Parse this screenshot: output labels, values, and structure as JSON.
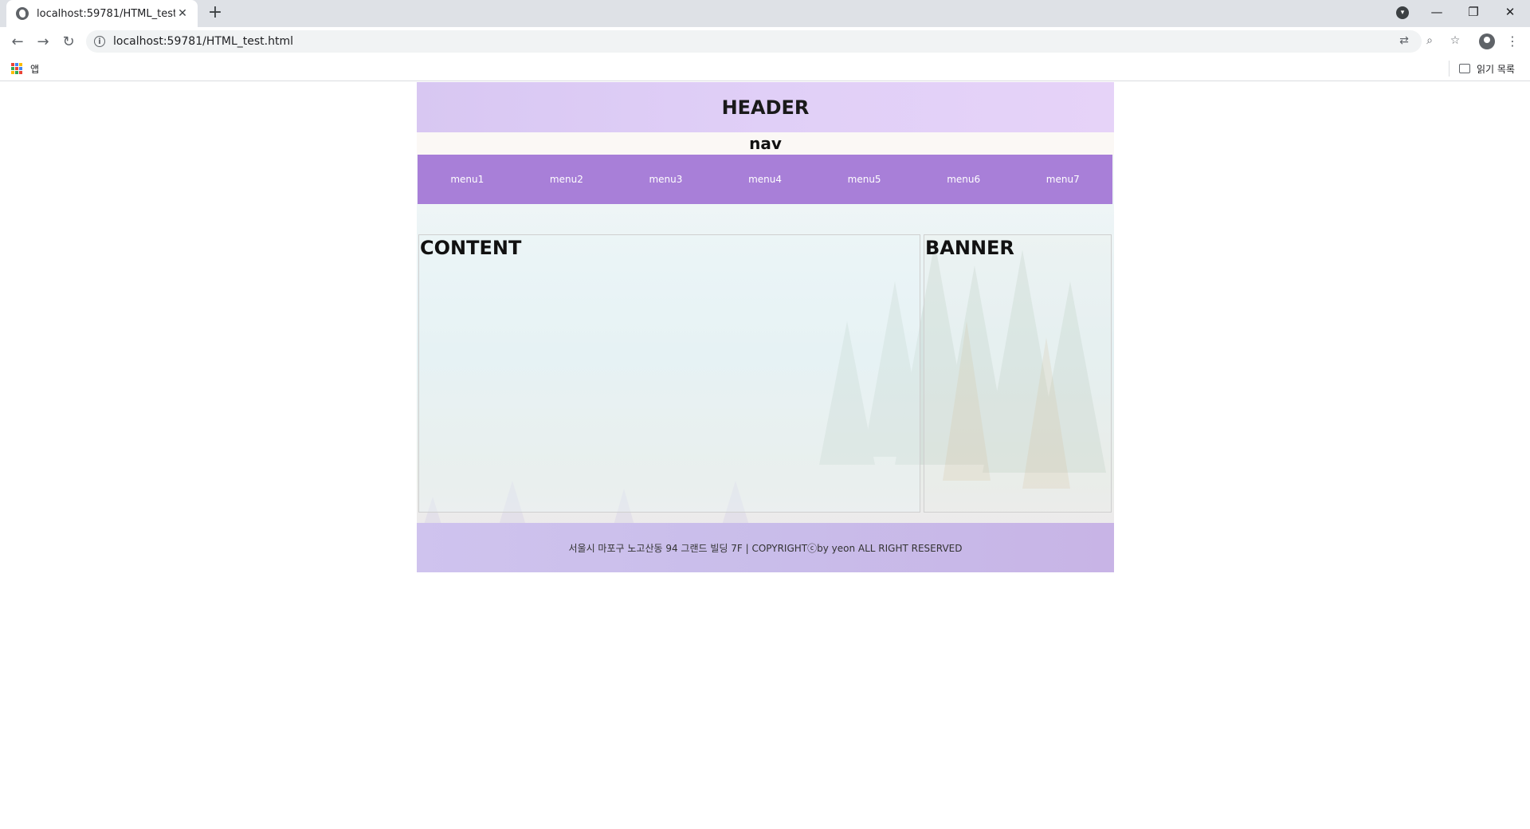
{
  "browser": {
    "tab_title": "localhost:59781/HTML_test.html",
    "tab_close": "✕",
    "new_tab": "+",
    "url": "localhost:59781/HTML_test.html",
    "back": "←",
    "forward": "→",
    "reload": "↻",
    "minimize": "—",
    "restore": "❐",
    "close": "✕",
    "bookmarks": {
      "apps_label": "앱",
      "reading_list_label": "읽기 목록"
    }
  },
  "page": {
    "header": "HEADER",
    "nav_title": "nav",
    "menu": [
      "menu1",
      "menu2",
      "menu3",
      "menu4",
      "menu5",
      "menu6",
      "menu7"
    ],
    "content_title": "CONTENT",
    "banner_title": "BANNER",
    "footer": "서울시 마포구 노고산동 94 그랜드 빌딩 7F | COPYRIGHTⓒby yeon ALL RIGHT RESERVED"
  },
  "colors": {
    "header_bg": "#dccbf5",
    "menu_bg": "#a87fd8",
    "footer_bg": "#cbbdea"
  }
}
